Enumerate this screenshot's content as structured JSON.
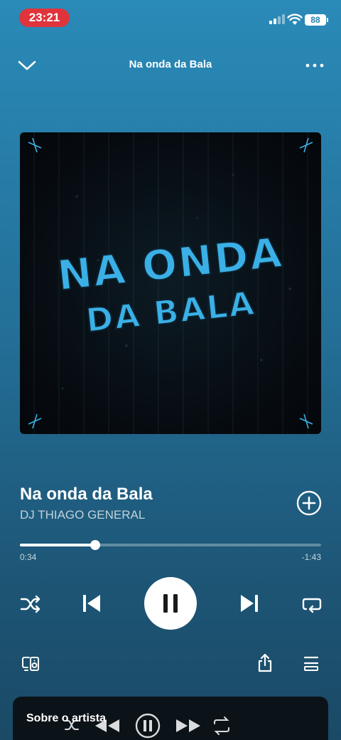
{
  "status_bar": {
    "time": "23:21",
    "battery": "88"
  },
  "header": {
    "title": "Na onda da Bala"
  },
  "artwork": {
    "line1": "NA ONDA",
    "line2": "DA BALA"
  },
  "track": {
    "title": "Na onda da Bala",
    "artist": "DJ THIAGO GENERAL"
  },
  "progress": {
    "elapsed": "0:34",
    "remaining": "-1:43",
    "fraction": 0.25
  },
  "about": {
    "label": "Sobre o artista"
  },
  "icons": {
    "collapse": "chevron-down-icon",
    "more": "more-horizontal-icon",
    "add": "add-circle-icon",
    "shuffle": "shuffle-icon",
    "previous": "skip-previous-icon",
    "pause": "pause-icon",
    "next": "skip-next-icon",
    "repeat": "repeat-icon",
    "devices": "devices-icon",
    "share": "share-icon",
    "queue": "queue-icon"
  },
  "colors": {
    "accent": "#3ab0e6",
    "time_pill": "#e0343c"
  }
}
